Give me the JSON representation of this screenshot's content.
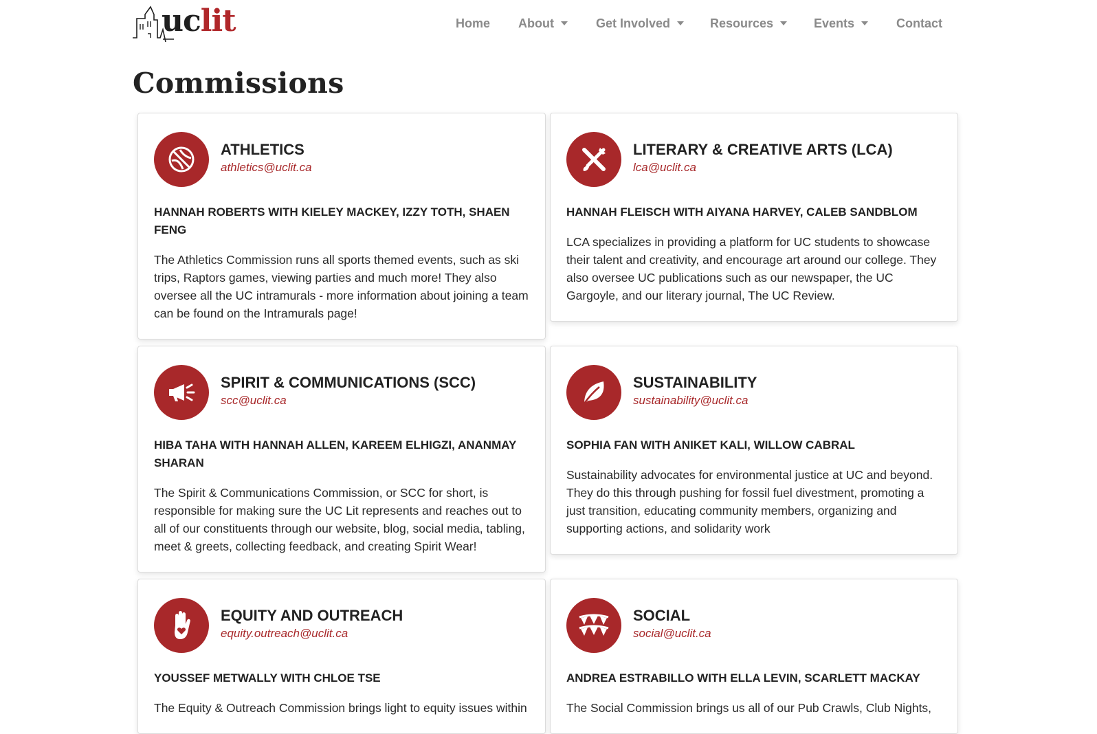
{
  "brand": {
    "logo_uc": "uc",
    "logo_lit": "lit",
    "accent_color": "#a8282a"
  },
  "nav": {
    "items": [
      {
        "label": "Home",
        "dropdown": false
      },
      {
        "label": "About",
        "dropdown": true
      },
      {
        "label": "Get Involved",
        "dropdown": true
      },
      {
        "label": "Resources",
        "dropdown": true
      },
      {
        "label": "Events",
        "dropdown": true
      },
      {
        "label": "Contact",
        "dropdown": false
      }
    ]
  },
  "page": {
    "title": "Commissions"
  },
  "commissions": [
    {
      "icon": "basketball-icon",
      "title": "ATHLETICS",
      "email": "athletics@uclit.ca",
      "members": "HANNAH ROBERTS WITH KIELEY MACKEY, IZZY TOTH, SHAEN FENG",
      "description": "The Athletics Commission runs all sports themed events, such as ski trips, Raptors games, viewing parties and much more! They also oversee all the UC intramurals - more information about joining a team can be found on the Intramurals page!"
    },
    {
      "icon": "pen-brush-crossed-icon",
      "title": "LITERARY & CREATIVE ARTS (LCA)",
      "email": "lca@uclit.ca",
      "members": "HANNAH FLEISCH WITH AIYANA HARVEY, CALEB SANDBLOM",
      "description": "LCA specializes in providing a platform for UC students to showcase their talent and creativity, and encourage art around our college. They also oversee UC publications such as our newspaper, the UC Gargoyle, and our literary journal, The UC Review."
    },
    {
      "icon": "megaphone-icon",
      "title": "SPIRIT & COMMUNICATIONS (SCC)",
      "email": "scc@uclit.ca",
      "members": "HIBA TAHA WITH HANNAH ALLEN, KAREEM ELHIGZI, ANANMAY SHARAN",
      "description": "The Spirit & Communications Commission, or SCC for short, is responsible for making sure the UC Lit represents and reaches out to all of our constituents through our website, blog, social media, tabling, meet & greets, collecting feedback, and creating Spirit Wear!"
    },
    {
      "icon": "leaf-icon",
      "title": "SUSTAINABILITY",
      "email": "sustainability@uclit.ca",
      "members": "SOPHIA FAN WITH ANIKET KALI, WILLOW CABRAL",
      "description": "Sustainability advocates for environmental justice at UC and beyond. They do this through pushing for fossil fuel divestment, promoting a just transition, educating community members, organizing and supporting actions, and solidarity work"
    },
    {
      "icon": "hand-heart-icon",
      "title": "EQUITY AND OUTREACH",
      "email": "equity.outreach@uclit.ca",
      "members": "YOUSSEF METWALLY WITH CHLOE TSE",
      "description": "The Equity & Outreach Commission brings light to equity issues within"
    },
    {
      "icon": "bunting-flags-icon",
      "title": "SOCIAL",
      "email": "social@uclit.ca",
      "members": "ANDREA ESTRABILLO WITH ELLA LEVIN, SCARLETT MACKAY",
      "description": "The Social Commission brings us all of our Pub Crawls, Club Nights,"
    }
  ]
}
